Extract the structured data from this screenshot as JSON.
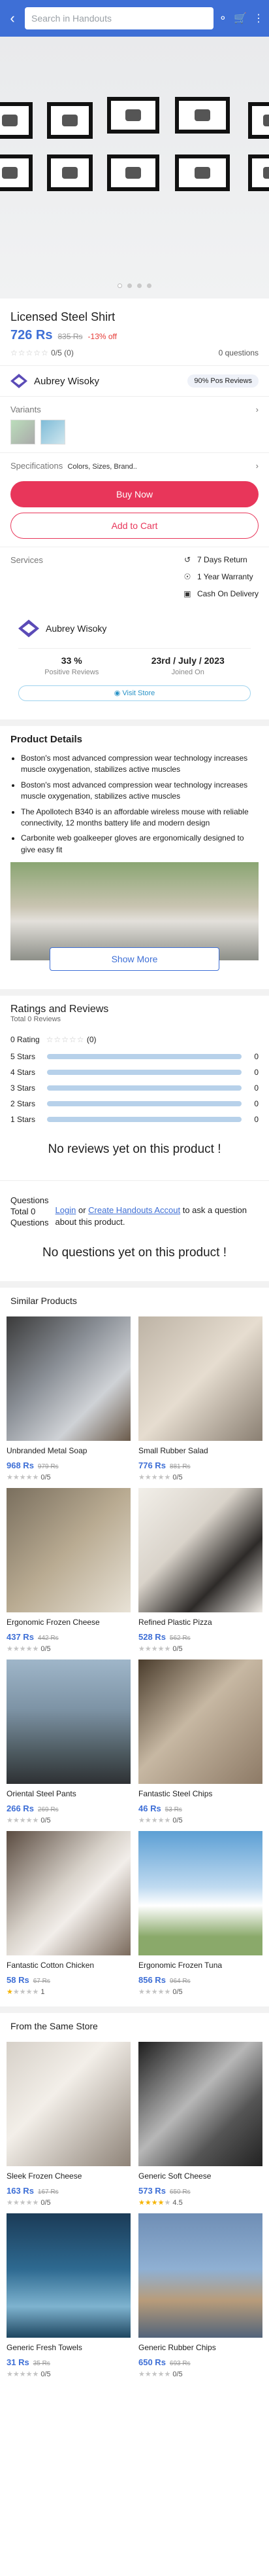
{
  "search": {
    "placeholder": "Search in Handouts"
  },
  "header": {
    "back_icon": "arrow-left-icon",
    "share_icon": "share-icon",
    "cart_icon": "cart-icon",
    "menu_icon": "more-vert-icon"
  },
  "product": {
    "title": "Licensed Steel Shirt",
    "price": "726 Rs",
    "old_price": "835 Rs",
    "discount": "-13% off",
    "rating_text": "0/5 (0)",
    "questions_count": "0 questions"
  },
  "seller_strip": {
    "name": "Aubrey Wisoky",
    "positive": "90% Pos Reviews"
  },
  "variants_label": "Variants",
  "specs": {
    "label": "Specifications",
    "value": "Colors, Sizes, Brand.."
  },
  "actions": {
    "buy": "Buy Now",
    "cart": "Add to Cart"
  },
  "services": {
    "label": "Services",
    "items": [
      "7 Days Return",
      "1 Year Warranty",
      "Cash On Delivery"
    ]
  },
  "store": {
    "name": "Aubrey Wisoky",
    "pos_val": "33 %",
    "pos_lbl": "Positive Reviews",
    "join_val": "23rd / July / 2023",
    "join_lbl": "Joined On",
    "visit": "Visit Store"
  },
  "details": {
    "heading": "Product Details",
    "bullets": [
      "Boston's most advanced compression wear technology increases muscle oxygenation, stabilizes active muscles",
      "Boston's most advanced compression wear technology increases muscle oxygenation, stabilizes active muscles",
      "The Apollotech B340 is an affordable wireless mouse with reliable connectivity, 12 months battery life and modern design",
      "Carbonite web goalkeeper gloves are ergonomically designed to give easy fit"
    ],
    "show_more": "Show More"
  },
  "reviews": {
    "heading": "Ratings and Reviews",
    "total": "Total 0 Reviews",
    "zero": "0 Rating",
    "zero_count": "(0)",
    "rows": [
      {
        "label": "5 Stars",
        "count": "0"
      },
      {
        "label": "4 Stars",
        "count": "0"
      },
      {
        "label": "3 Stars",
        "count": "0"
      },
      {
        "label": "2 Stars",
        "count": "0"
      },
      {
        "label": "1 Stars",
        "count": "0"
      }
    ],
    "empty": "No reviews yet on this product !"
  },
  "questions": {
    "heading": "Questions",
    "total_lbl": "Total 0",
    "total_q": "Questions",
    "login": "Login",
    "or": "or",
    "create": "Create Handouts Accout",
    "tail": "to ask a question about this product.",
    "empty": "No questions yet on this product !"
  },
  "similar": {
    "heading": "Similar Products",
    "items": [
      {
        "name": "Unbranded Metal Soap",
        "price": "968 Rs",
        "old": "979 Rs",
        "rating": "0/5"
      },
      {
        "name": "Small Rubber Salad",
        "price": "776 Rs",
        "old": "881 Rs",
        "rating": "0/5"
      },
      {
        "name": "Ergonomic Frozen Cheese",
        "price": "437 Rs",
        "old": "442 Rs",
        "rating": "0/5"
      },
      {
        "name": "Refined Plastic Pizza",
        "price": "528 Rs",
        "old": "562 Rs",
        "rating": "0/5"
      },
      {
        "name": "Oriental Steel Pants",
        "price": "266 Rs",
        "old": "269 Rs",
        "rating": "0/5"
      },
      {
        "name": "Fantastic Steel Chips",
        "price": "46 Rs",
        "old": "53 Rs",
        "rating": "0/5"
      },
      {
        "name": "Fantastic Cotton Chicken",
        "price": "58 Rs",
        "old": "67 Rs",
        "rating": "1"
      },
      {
        "name": "Ergonomic Frozen Tuna",
        "price": "856 Rs",
        "old": "964 Rs",
        "rating": "0/5"
      }
    ]
  },
  "same_store": {
    "heading": "From the Same Store",
    "items": [
      {
        "name": "Sleek Frozen Cheese",
        "price": "163 Rs",
        "old": "167 Rs",
        "rating": "0/5"
      },
      {
        "name": "Generic Soft Cheese",
        "price": "573 Rs",
        "old": "650 Rs",
        "rating": "4.5"
      },
      {
        "name": "Generic Fresh Towels",
        "price": "31 Rs",
        "old": "35 Rs",
        "rating": "0/5"
      },
      {
        "name": "Generic Rubber Chips",
        "price": "650 Rs",
        "old": "693 Rs",
        "rating": "0/5"
      }
    ]
  },
  "colors": {
    "accent": "#3e6fd6",
    "buy": "#e8365a",
    "bar": "#b7d1ea"
  }
}
